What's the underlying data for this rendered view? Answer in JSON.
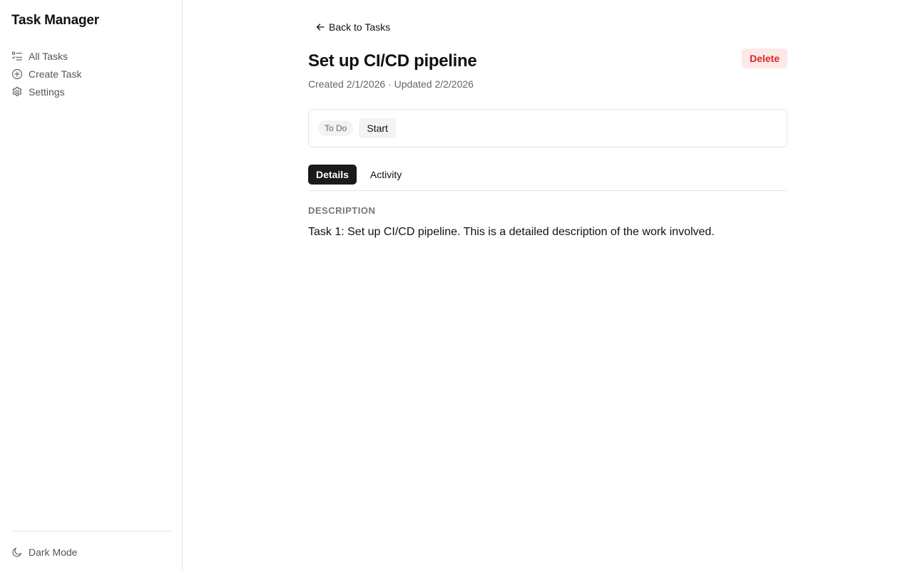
{
  "sidebar": {
    "app_title": "Task Manager",
    "items": [
      {
        "label": "All Tasks",
        "icon": "list-icon"
      },
      {
        "label": "Create Task",
        "icon": "plus-circle-icon"
      },
      {
        "label": "Settings",
        "icon": "gear-icon"
      }
    ],
    "footer": {
      "dark_mode_label": "Dark Mode",
      "icon": "moon-icon"
    }
  },
  "main": {
    "back_label": "Back to Tasks",
    "title": "Set up CI/CD pipeline",
    "meta": "Created 2/1/2026 · Updated 2/2/2026",
    "delete_label": "Delete",
    "status": {
      "badge": "To Do",
      "action_label": "Start"
    },
    "tabs": [
      {
        "label": "Details",
        "active": true
      },
      {
        "label": "Activity",
        "active": false
      }
    ],
    "section_label": "DESCRIPTION",
    "description": "Task 1: Set up CI/CD pipeline. This is a detailed description of the work involved."
  },
  "colors": {
    "danger": "#dc2626",
    "danger_bg": "#fde8e8",
    "active_tab_bg": "#1a1a1a",
    "border": "#e5e5e5"
  }
}
